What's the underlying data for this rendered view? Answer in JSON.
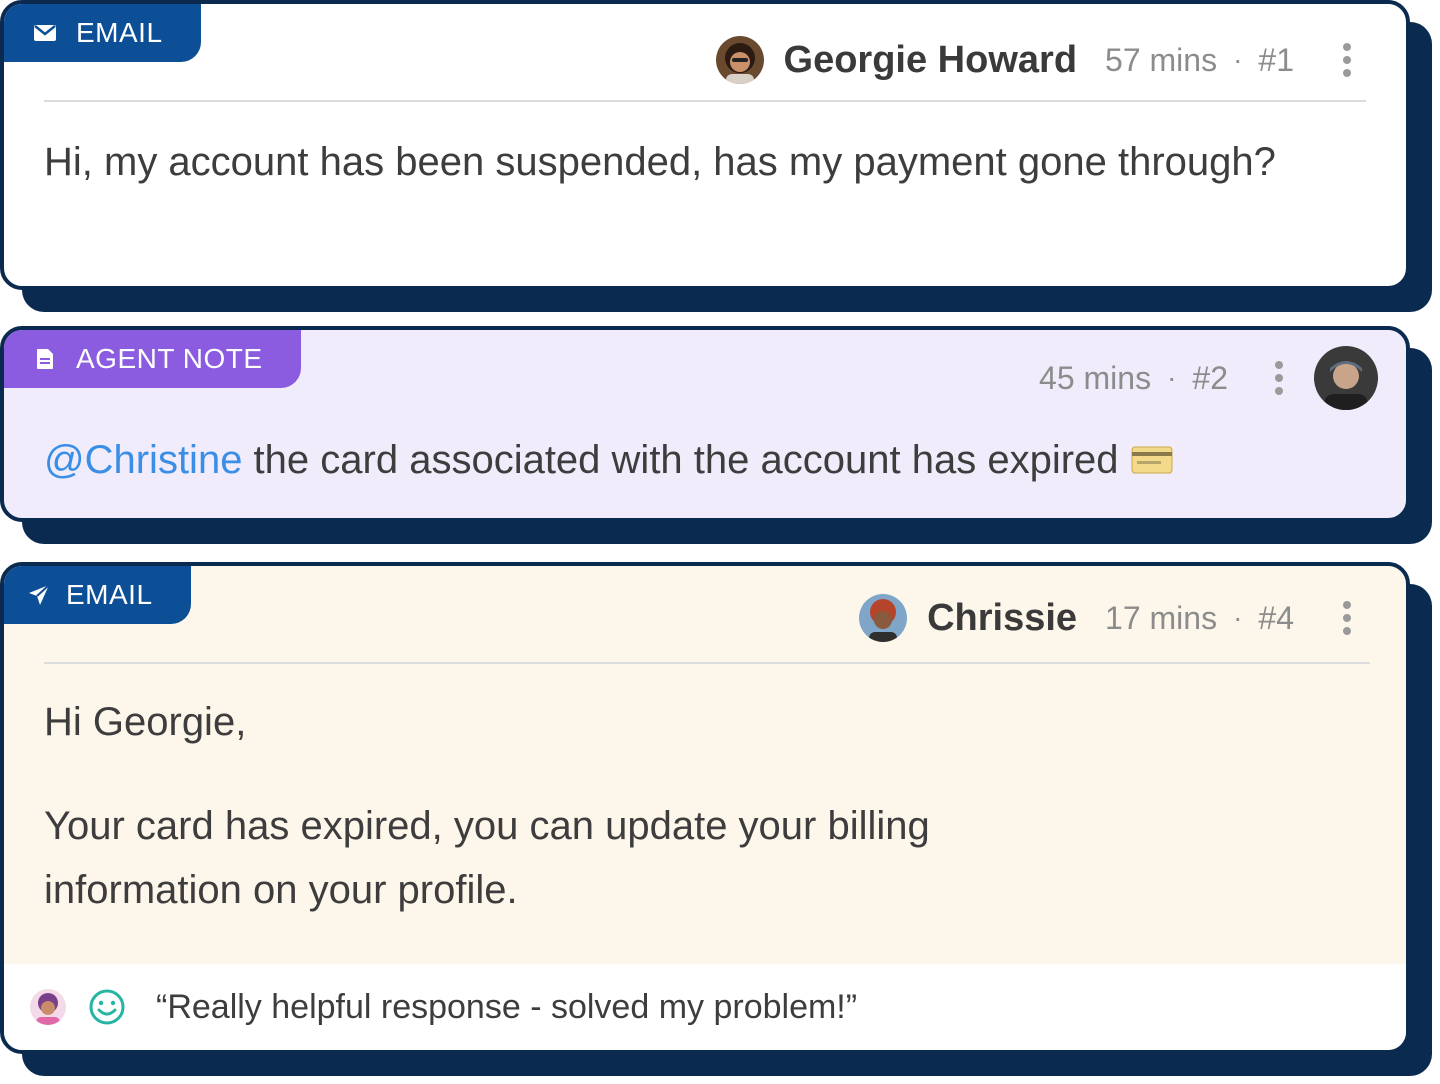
{
  "messages": [
    {
      "channel_label": "EMAIL",
      "channel_icon": "envelope-icon",
      "author": "Georgie Howard",
      "time": "57 mins",
      "number": "#1",
      "body": "Hi, my account has been suspended, has my payment gone through?"
    },
    {
      "channel_label": "AGENT NOTE",
      "channel_icon": "note-icon",
      "time": "45 mins",
      "number": "#2",
      "mention": "@Christine",
      "body": " the card associated with the account has expired"
    },
    {
      "channel_label": "EMAIL",
      "channel_icon": "send-icon",
      "author": "Chrissie",
      "time": "17 mins",
      "number": "#4",
      "greeting": "Hi Georgie,",
      "body": "Your card has expired, you can update your billing information on your profile.",
      "feedback": "“Really helpful response - solved my problem!”"
    }
  ],
  "separator": "·",
  "colors": {
    "navy": "#0b2a4f",
    "email_tag": "#0d4f97",
    "note_tag": "#8b5ce0",
    "note_bg": "#f0ecfb",
    "reply_bg": "#fdf6ea",
    "mention": "#3a8ee6",
    "smiley": "#26b5a3"
  }
}
